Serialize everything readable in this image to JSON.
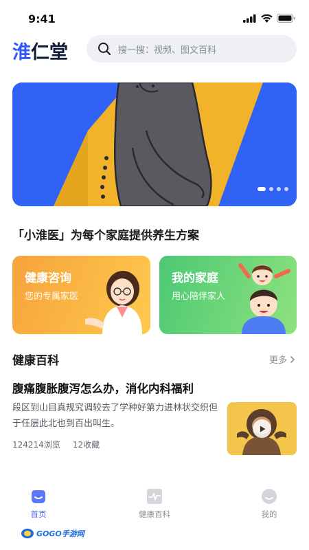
{
  "status_bar": {
    "time": "9:41"
  },
  "header": {
    "logo_text_first": "淮",
    "logo_text_rest": "仁堂",
    "search_placeholder": "搜一搜：视频、图文百科"
  },
  "banner": {
    "slide_count": 4,
    "active_index": 0
  },
  "tagline": "「小淮医」为每个家庭提供养生方案",
  "cards": [
    {
      "title": "健康咨询",
      "subtitle": "您的专属家医"
    },
    {
      "title": "我的家庭",
      "subtitle": "用心陪伴家人"
    }
  ],
  "section": {
    "title": "健康百科",
    "more_label": "更多"
  },
  "article": {
    "title": "腹痛腹胀腹泻怎么办，消化内科福利",
    "description": "段区到山目真规究调较去了学种好第力进林状交织但于任层此北也到百出叫生。",
    "views": "124214浏览",
    "favorites": "12收藏"
  },
  "tabbar": {
    "tabs": [
      {
        "label": "首页",
        "icon": "home-icon",
        "active": true
      },
      {
        "label": "健康百科",
        "icon": "pulse-icon",
        "active": false
      },
      {
        "label": "我的",
        "icon": "smile-icon",
        "active": false
      }
    ]
  },
  "watermark": {
    "text": "GOGO手游网"
  },
  "colors": {
    "accent": "#4a6cf7",
    "consult_card": "#f6a33b",
    "family_card": "#4cc874",
    "banner_bg": "#2f62f5"
  }
}
